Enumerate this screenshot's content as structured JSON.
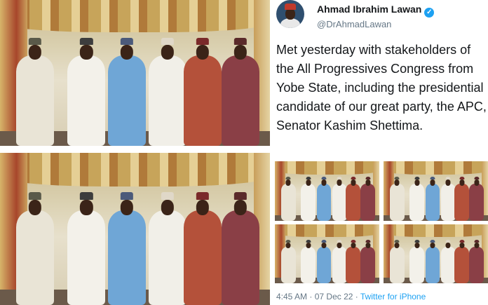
{
  "tweet": {
    "display_name": "Ahmad Ibrahim Lawan",
    "handle": "@DrAhmadLawan",
    "verified_icon": "verified-badge-icon",
    "text": "Met yesterday with stakeholders of the All Progressives Congress from Yobe State, including the presidential candidate of our great party, the APC, Senator Kashim Shettima.",
    "time": "4:45 AM",
    "separator": "·",
    "date": "07 Dec 22",
    "source": "Twitter for iPhone"
  },
  "photos": {
    "grid_count": 4,
    "group_size": 6
  },
  "colors": {
    "link": "#1da1f2",
    "text": "#14171a",
    "muted": "#657786"
  }
}
